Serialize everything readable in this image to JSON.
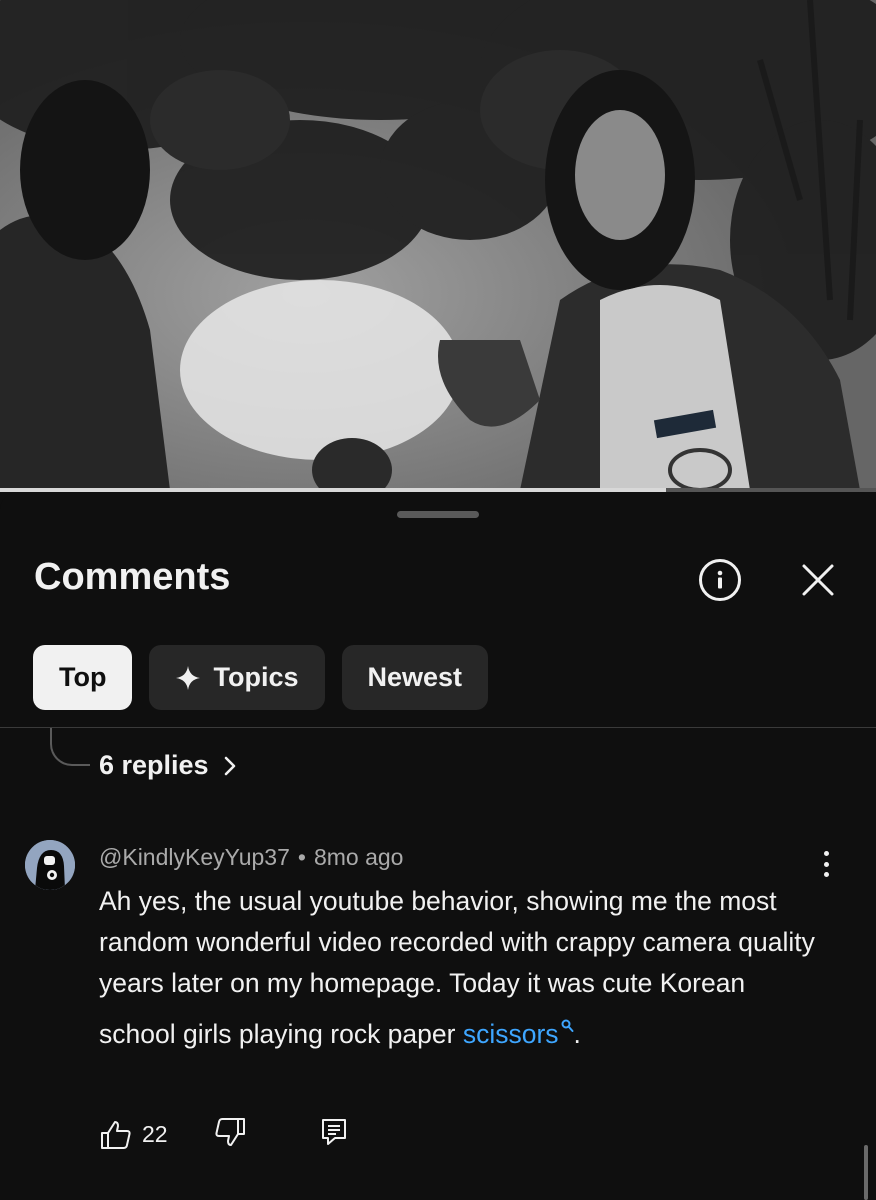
{
  "video": {
    "progress": 0.76
  },
  "comments_panel": {
    "title": "Comments",
    "info_icon": "info-icon",
    "close_icon": "close-icon",
    "filters": [
      {
        "label": "Top",
        "active": true
      },
      {
        "label": "Topics",
        "active": false,
        "icon": "sparkle-icon"
      },
      {
        "label": "Newest",
        "active": false
      }
    ],
    "replies_link": "6 replies"
  },
  "comment": {
    "author": "@KindlyKeyYup37",
    "separator": "•",
    "time": "8mo ago",
    "text": "Ah yes, the usual youtube behavior, showing me the most random wonderful video recorded with crappy camera quality years later on my homepage. Today it was cute Korean school girls playing rock paper ",
    "link_text": "scissors",
    "text_end": ".",
    "likes": "22"
  },
  "colors": {
    "background": "#0f0f0f",
    "chip": "#272727",
    "chip_active": "#f1f1f1",
    "link": "#3ea6ff",
    "meta": "#aaaaaa"
  }
}
